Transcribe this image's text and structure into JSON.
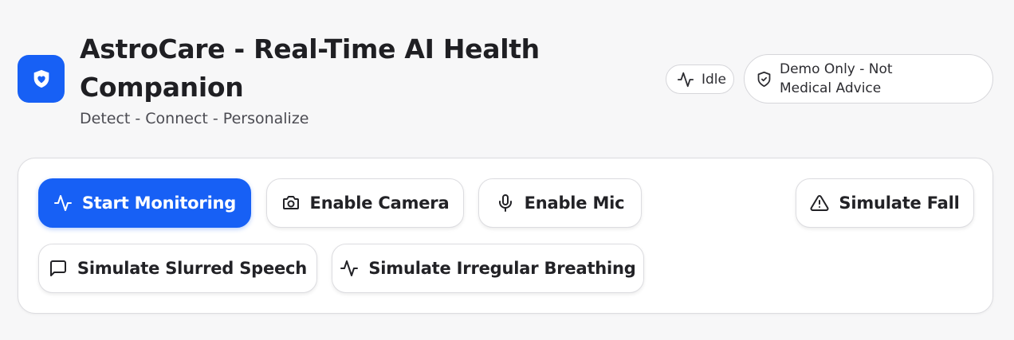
{
  "header": {
    "logo_icon": "heart-shield-icon",
    "title": "AstroCare - Real-Time AI Health Companion",
    "subtitle": "Detect - Connect - Personalize"
  },
  "status_pills": {
    "status": {
      "icon": "activity-icon",
      "label": "Idle"
    },
    "disclaimer": {
      "icon": "shield-check-icon",
      "label": "Demo Only - Not Medical Advice"
    }
  },
  "controls": {
    "start_monitoring": {
      "icon": "activity-icon",
      "label": "Start Monitoring"
    },
    "enable_camera": {
      "icon": "camera-icon",
      "label": "Enable Camera"
    },
    "enable_mic": {
      "icon": "microphone-icon",
      "label": "Enable Mic"
    },
    "simulate_fall": {
      "icon": "warning-triangle-icon",
      "label": "Simulate Fall"
    },
    "simulate_slurred_speech": {
      "icon": "message-square-icon",
      "label": "Simulate Slurred Speech"
    },
    "simulate_irregular_breathing": {
      "icon": "activity-icon",
      "label": "Simulate Irregular Breathing"
    }
  },
  "colors": {
    "accent": "#1760f5",
    "background": "#f7f7f8",
    "card": "#ffffff",
    "border": "#dcdce0"
  }
}
